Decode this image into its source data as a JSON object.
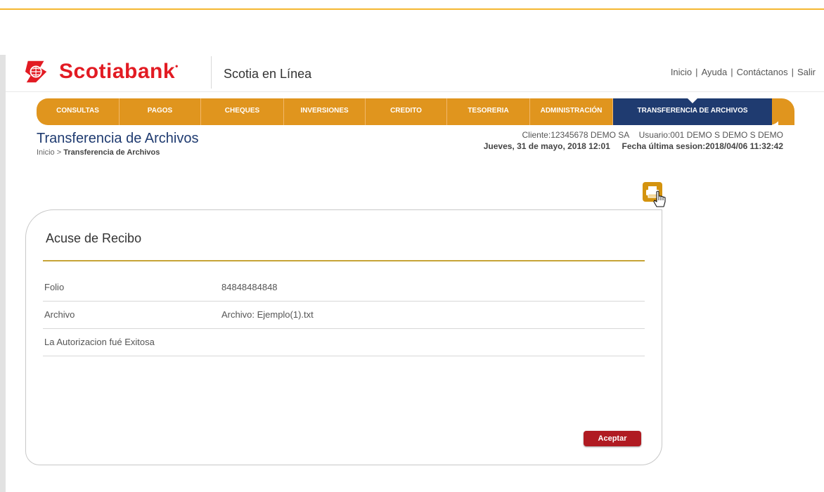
{
  "header": {
    "brand": "Scotiabank",
    "product": "Scotia en Línea",
    "links": [
      "Inicio",
      "Ayuda",
      "Contáctanos",
      "Salir"
    ]
  },
  "nav": {
    "items": [
      {
        "label": "CONSULTAS"
      },
      {
        "label": "PAGOS"
      },
      {
        "label": "CHEQUES"
      },
      {
        "label": "INVERSIONES"
      },
      {
        "label": "CREDITO"
      },
      {
        "label": "TESORERIA"
      },
      {
        "label": "ADMINISTRACIÓN"
      },
      {
        "label": "TRANSFERENCIA DE ARCHIVOS",
        "active": true
      }
    ]
  },
  "page": {
    "title": "Transferencia de Archivos",
    "breadcrumb_home": "Inicio",
    "breadcrumb_sep": " > ",
    "breadcrumb_current": "Transferencia de Archivos"
  },
  "session": {
    "client": "Cliente:12345678  DEMO SA",
    "user": "Usuario:001 DEMO S DEMO S DEMO",
    "date": "Jueves, 31 de mayo, 2018 12:01",
    "last_session": "Fecha última sesion:2018/04/06 11:32:42"
  },
  "receipt": {
    "title": "Acuse de Recibo",
    "rows": [
      {
        "label": "Folio",
        "value": "84848484848"
      },
      {
        "label": "Archivo",
        "value": "Archivo: Ejemplo(1).txt"
      },
      {
        "label": "La Autorizacion fué Exitosa",
        "value": ""
      }
    ],
    "accept_label": "Aceptar"
  },
  "icons": {
    "logo": "scotiabank-s-logo",
    "print": "printer-icon",
    "cursor": "hand-cursor-icon"
  },
  "colors": {
    "brand_red": "#e21b23",
    "nav_orange": "#e0951e",
    "nav_active": "#1f3b70",
    "accent_gold": "#c6a437",
    "accept_red": "#b01b22"
  }
}
